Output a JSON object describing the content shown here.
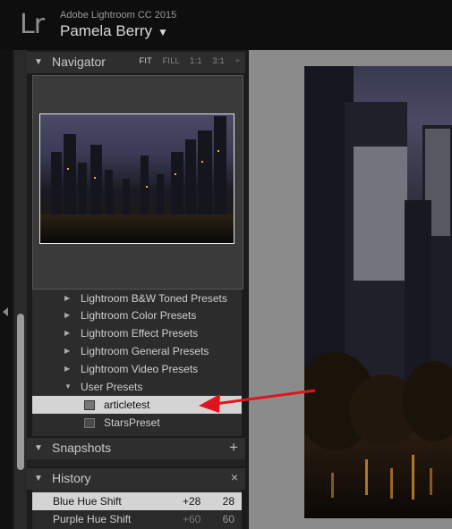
{
  "app": {
    "logo": "Lr",
    "name": "Adobe Lightroom CC 2015",
    "catalog_owner": "Pamela Berry",
    "catalog_menu_glyph": "▼"
  },
  "navigator": {
    "title": "Navigator",
    "collapse_glyph": "▼",
    "zoom_modes": [
      "FIT",
      "FILL",
      "1:1",
      "3:1"
    ],
    "active_zoom": "FIT",
    "zoom_menu_glyph": "÷"
  },
  "presets": {
    "folders": [
      {
        "label": "Lightroom B&W Toned Presets",
        "expanded": false
      },
      {
        "label": "Lightroom Color Presets",
        "expanded": false
      },
      {
        "label": "Lightroom Effect Presets",
        "expanded": false
      },
      {
        "label": "Lightroom General Presets",
        "expanded": false
      },
      {
        "label": "Lightroom Video Presets",
        "expanded": false
      },
      {
        "label": "User Presets",
        "expanded": true
      }
    ],
    "user_presets": [
      {
        "label": "articletest",
        "selected": true
      },
      {
        "label": "StarsPreset",
        "selected": false
      }
    ],
    "expanded_glyph": "▼",
    "collapsed_glyph": "▶"
  },
  "snapshots": {
    "title": "Snapshots",
    "add_glyph": "+"
  },
  "history": {
    "title": "History",
    "clear_glyph": "×",
    "steps": [
      {
        "label": "Blue Hue Shift",
        "change": "+28",
        "value": "28",
        "selected": true
      },
      {
        "label": "Purple Hue Shift",
        "change": "+60",
        "value": "60",
        "selected": false
      }
    ]
  },
  "colors": {
    "annotation_arrow": "#e0141e",
    "selected_row": "#d4d4d4",
    "panel_bg": "#2e2e2e",
    "main_bg": "#8b8b8b"
  }
}
